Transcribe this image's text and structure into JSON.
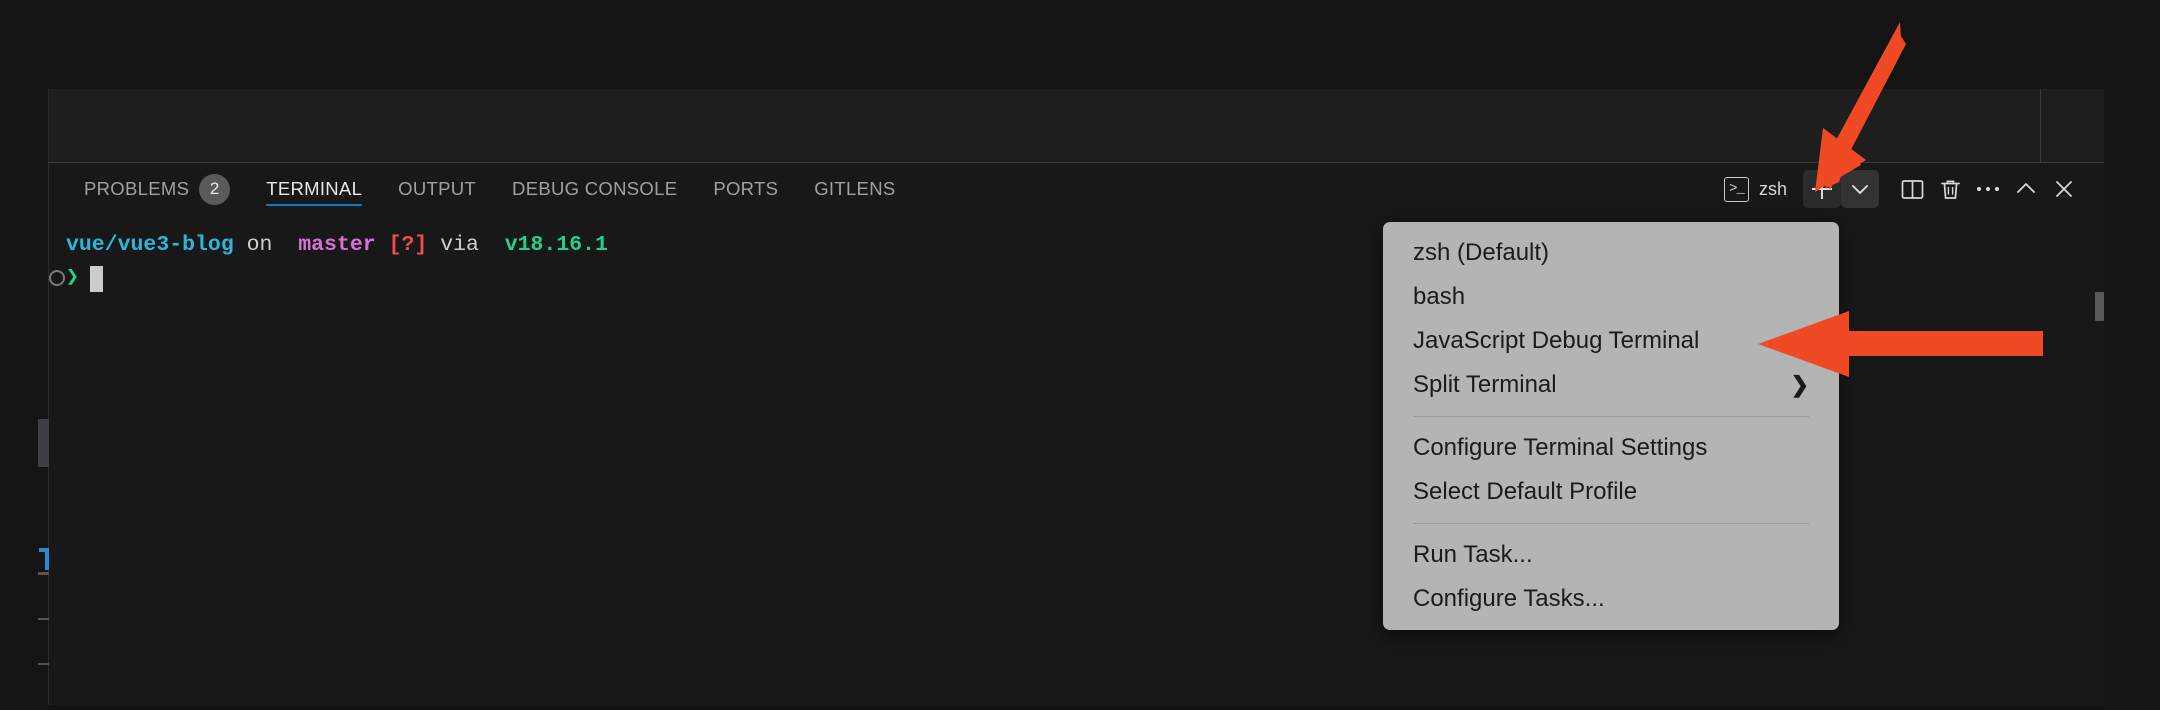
{
  "window": {
    "background_color": "#141414",
    "panel_background": "#181818"
  },
  "panel": {
    "tabs": [
      {
        "label": "PROBLEMS",
        "badge": "2",
        "active": false
      },
      {
        "label": "TERMINAL",
        "badge": null,
        "active": true
      },
      {
        "label": "OUTPUT",
        "badge": null,
        "active": false
      },
      {
        "label": "DEBUG CONSOLE",
        "badge": null,
        "active": false
      },
      {
        "label": "PORTS",
        "badge": null,
        "active": false
      },
      {
        "label": "GITLENS",
        "badge": null,
        "active": false
      }
    ],
    "active_tab_underline_color": "#0f7bd1",
    "actions": {
      "terminal_chip_label": "zsh",
      "terminal_chip_glyph": ">_",
      "new_terminal_label": "+",
      "profile_dropdown_label": "⌄",
      "split_label": "",
      "kill_label": "",
      "more_label": "...",
      "maximize_label": "^",
      "close_label": "✕"
    }
  },
  "terminal": {
    "prompt_segments": {
      "repo": "vue/vue3-blog",
      "on_word": " on ",
      "branch_icon": "",
      "branch": "master",
      "dirty_flag": "[?]",
      "via_word": " via ",
      "node_icon": "",
      "node_version": "v18.16.1"
    },
    "prompt_caret": "❯",
    "cursor": "",
    "colors": {
      "repo": "#29b8db",
      "branch": "#d670d6",
      "dirty": "#f14c4c",
      "node": "#23d18b",
      "text": "#cfcfcf"
    }
  },
  "context_menu": {
    "groups": [
      {
        "items": [
          {
            "label": "zsh (Default)",
            "submenu": false
          },
          {
            "label": "bash",
            "submenu": false
          },
          {
            "label": "JavaScript Debug Terminal",
            "submenu": false
          },
          {
            "label": "Split Terminal",
            "submenu": true,
            "submenu_arrow": "❯"
          }
        ]
      },
      {
        "items": [
          {
            "label": "Configure Terminal Settings",
            "submenu": false
          },
          {
            "label": "Select Default Profile",
            "submenu": false
          }
        ]
      },
      {
        "items": [
          {
            "label": "Run Task...",
            "submenu": false
          },
          {
            "label": "Configure Tasks...",
            "submenu": false
          }
        ]
      }
    ],
    "background_color": "#b4b4b4",
    "text_color": "#1b1b1b"
  },
  "annotations": {
    "arrow_color": "#f04a25",
    "arrows": [
      {
        "name": "arrow-pointing-to-profile-dropdown",
        "direction": "down-left"
      },
      {
        "name": "arrow-pointing-to-javascript-debug-terminal",
        "direction": "left"
      }
    ]
  }
}
